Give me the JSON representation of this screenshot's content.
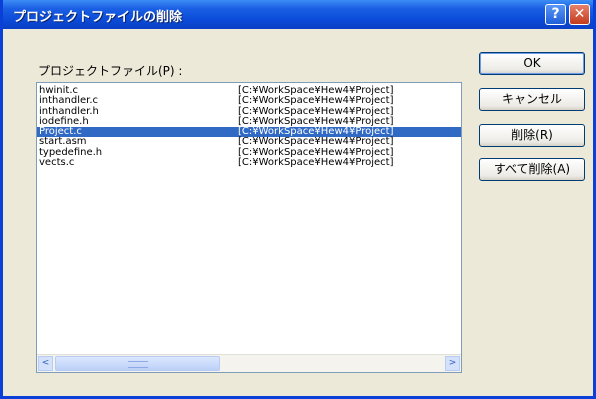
{
  "window": {
    "title": "プロジェクトファイルの削除",
    "help_glyph": "?",
    "close_glyph": "✕"
  },
  "list": {
    "label": "プロジェクトファイル(P) :",
    "selected_index": 4,
    "items": [
      {
        "name": "hwinit.c",
        "path": "[C:¥WorkSpace¥Hew4¥Project]"
      },
      {
        "name": "inthandler.c",
        "path": "[C:¥WorkSpace¥Hew4¥Project]"
      },
      {
        "name": "inthandler.h",
        "path": "[C:¥WorkSpace¥Hew4¥Project]"
      },
      {
        "name": "iodefine.h",
        "path": "[C:¥WorkSpace¥Hew4¥Project]"
      },
      {
        "name": "Project.c",
        "path": "[C:¥WorkSpace¥Hew4¥Project]"
      },
      {
        "name": "start.asm",
        "path": "[C:¥WorkSpace¥Hew4¥Project]"
      },
      {
        "name": "typedefine.h",
        "path": "[C:¥WorkSpace¥Hew4¥Project]"
      },
      {
        "name": "vects.c",
        "path": "[C:¥WorkSpace¥Hew4¥Project]"
      }
    ],
    "scroll_left_glyph": "<",
    "scroll_right_glyph": ">"
  },
  "buttons": {
    "ok": "OK",
    "cancel": "キャンセル",
    "remove": "削除(R)",
    "remove_all": "すべて削除(A)"
  },
  "colors": {
    "title_bar": "#0a4bd8",
    "selection": "#316ac5",
    "dialog_face": "#ece9d8"
  }
}
